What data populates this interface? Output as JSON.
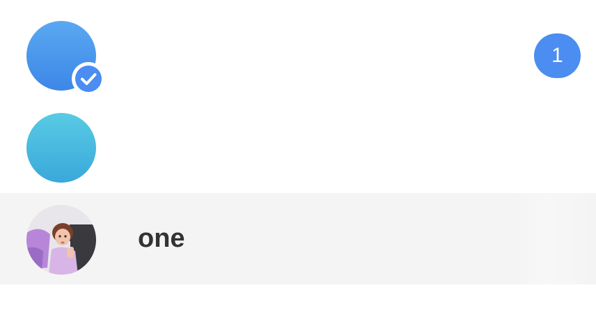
{
  "chat_list": {
    "items": [
      {
        "avatar": "blue-circle-avatar",
        "verified_icon": "check-circle-icon",
        "unread_count": "1",
        "accent_color": "#4b8df0"
      },
      {
        "avatar": "cyan-circle-avatar"
      },
      {
        "avatar": "photo-avatar-child",
        "name": "one"
      }
    ]
  }
}
